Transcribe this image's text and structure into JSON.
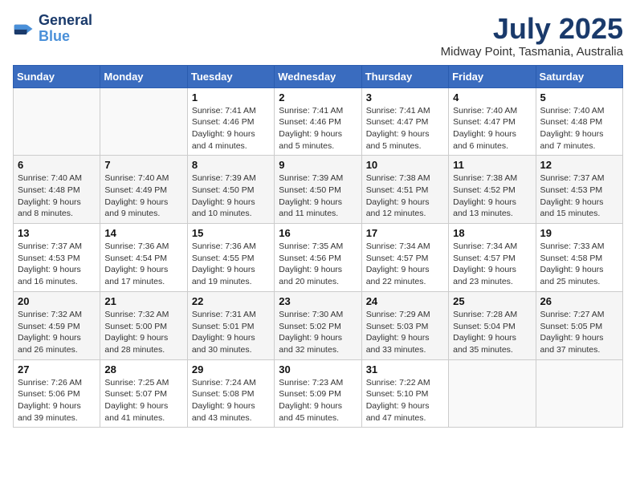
{
  "header": {
    "logo_line1": "General",
    "logo_line2": "Blue",
    "month": "July 2025",
    "location": "Midway Point, Tasmania, Australia"
  },
  "weekdays": [
    "Sunday",
    "Monday",
    "Tuesday",
    "Wednesday",
    "Thursday",
    "Friday",
    "Saturday"
  ],
  "weeks": [
    [
      {
        "day": "",
        "sunrise": "",
        "sunset": "",
        "daylight": ""
      },
      {
        "day": "",
        "sunrise": "",
        "sunset": "",
        "daylight": ""
      },
      {
        "day": "1",
        "sunrise": "Sunrise: 7:41 AM",
        "sunset": "Sunset: 4:46 PM",
        "daylight": "Daylight: 9 hours and 4 minutes."
      },
      {
        "day": "2",
        "sunrise": "Sunrise: 7:41 AM",
        "sunset": "Sunset: 4:46 PM",
        "daylight": "Daylight: 9 hours and 5 minutes."
      },
      {
        "day": "3",
        "sunrise": "Sunrise: 7:41 AM",
        "sunset": "Sunset: 4:47 PM",
        "daylight": "Daylight: 9 hours and 5 minutes."
      },
      {
        "day": "4",
        "sunrise": "Sunrise: 7:40 AM",
        "sunset": "Sunset: 4:47 PM",
        "daylight": "Daylight: 9 hours and 6 minutes."
      },
      {
        "day": "5",
        "sunrise": "Sunrise: 7:40 AM",
        "sunset": "Sunset: 4:48 PM",
        "daylight": "Daylight: 9 hours and 7 minutes."
      }
    ],
    [
      {
        "day": "6",
        "sunrise": "Sunrise: 7:40 AM",
        "sunset": "Sunset: 4:48 PM",
        "daylight": "Daylight: 9 hours and 8 minutes."
      },
      {
        "day": "7",
        "sunrise": "Sunrise: 7:40 AM",
        "sunset": "Sunset: 4:49 PM",
        "daylight": "Daylight: 9 hours and 9 minutes."
      },
      {
        "day": "8",
        "sunrise": "Sunrise: 7:39 AM",
        "sunset": "Sunset: 4:50 PM",
        "daylight": "Daylight: 9 hours and 10 minutes."
      },
      {
        "day": "9",
        "sunrise": "Sunrise: 7:39 AM",
        "sunset": "Sunset: 4:50 PM",
        "daylight": "Daylight: 9 hours and 11 minutes."
      },
      {
        "day": "10",
        "sunrise": "Sunrise: 7:38 AM",
        "sunset": "Sunset: 4:51 PM",
        "daylight": "Daylight: 9 hours and 12 minutes."
      },
      {
        "day": "11",
        "sunrise": "Sunrise: 7:38 AM",
        "sunset": "Sunset: 4:52 PM",
        "daylight": "Daylight: 9 hours and 13 minutes."
      },
      {
        "day": "12",
        "sunrise": "Sunrise: 7:37 AM",
        "sunset": "Sunset: 4:53 PM",
        "daylight": "Daylight: 9 hours and 15 minutes."
      }
    ],
    [
      {
        "day": "13",
        "sunrise": "Sunrise: 7:37 AM",
        "sunset": "Sunset: 4:53 PM",
        "daylight": "Daylight: 9 hours and 16 minutes."
      },
      {
        "day": "14",
        "sunrise": "Sunrise: 7:36 AM",
        "sunset": "Sunset: 4:54 PM",
        "daylight": "Daylight: 9 hours and 17 minutes."
      },
      {
        "day": "15",
        "sunrise": "Sunrise: 7:36 AM",
        "sunset": "Sunset: 4:55 PM",
        "daylight": "Daylight: 9 hours and 19 minutes."
      },
      {
        "day": "16",
        "sunrise": "Sunrise: 7:35 AM",
        "sunset": "Sunset: 4:56 PM",
        "daylight": "Daylight: 9 hours and 20 minutes."
      },
      {
        "day": "17",
        "sunrise": "Sunrise: 7:34 AM",
        "sunset": "Sunset: 4:57 PM",
        "daylight": "Daylight: 9 hours and 22 minutes."
      },
      {
        "day": "18",
        "sunrise": "Sunrise: 7:34 AM",
        "sunset": "Sunset: 4:57 PM",
        "daylight": "Daylight: 9 hours and 23 minutes."
      },
      {
        "day": "19",
        "sunrise": "Sunrise: 7:33 AM",
        "sunset": "Sunset: 4:58 PM",
        "daylight": "Daylight: 9 hours and 25 minutes."
      }
    ],
    [
      {
        "day": "20",
        "sunrise": "Sunrise: 7:32 AM",
        "sunset": "Sunset: 4:59 PM",
        "daylight": "Daylight: 9 hours and 26 minutes."
      },
      {
        "day": "21",
        "sunrise": "Sunrise: 7:32 AM",
        "sunset": "Sunset: 5:00 PM",
        "daylight": "Daylight: 9 hours and 28 minutes."
      },
      {
        "day": "22",
        "sunrise": "Sunrise: 7:31 AM",
        "sunset": "Sunset: 5:01 PM",
        "daylight": "Daylight: 9 hours and 30 minutes."
      },
      {
        "day": "23",
        "sunrise": "Sunrise: 7:30 AM",
        "sunset": "Sunset: 5:02 PM",
        "daylight": "Daylight: 9 hours and 32 minutes."
      },
      {
        "day": "24",
        "sunrise": "Sunrise: 7:29 AM",
        "sunset": "Sunset: 5:03 PM",
        "daylight": "Daylight: 9 hours and 33 minutes."
      },
      {
        "day": "25",
        "sunrise": "Sunrise: 7:28 AM",
        "sunset": "Sunset: 5:04 PM",
        "daylight": "Daylight: 9 hours and 35 minutes."
      },
      {
        "day": "26",
        "sunrise": "Sunrise: 7:27 AM",
        "sunset": "Sunset: 5:05 PM",
        "daylight": "Daylight: 9 hours and 37 minutes."
      }
    ],
    [
      {
        "day": "27",
        "sunrise": "Sunrise: 7:26 AM",
        "sunset": "Sunset: 5:06 PM",
        "daylight": "Daylight: 9 hours and 39 minutes."
      },
      {
        "day": "28",
        "sunrise": "Sunrise: 7:25 AM",
        "sunset": "Sunset: 5:07 PM",
        "daylight": "Daylight: 9 hours and 41 minutes."
      },
      {
        "day": "29",
        "sunrise": "Sunrise: 7:24 AM",
        "sunset": "Sunset: 5:08 PM",
        "daylight": "Daylight: 9 hours and 43 minutes."
      },
      {
        "day": "30",
        "sunrise": "Sunrise: 7:23 AM",
        "sunset": "Sunset: 5:09 PM",
        "daylight": "Daylight: 9 hours and 45 minutes."
      },
      {
        "day": "31",
        "sunrise": "Sunrise: 7:22 AM",
        "sunset": "Sunset: 5:10 PM",
        "daylight": "Daylight: 9 hours and 47 minutes."
      },
      {
        "day": "",
        "sunrise": "",
        "sunset": "",
        "daylight": ""
      },
      {
        "day": "",
        "sunrise": "",
        "sunset": "",
        "daylight": ""
      }
    ]
  ]
}
